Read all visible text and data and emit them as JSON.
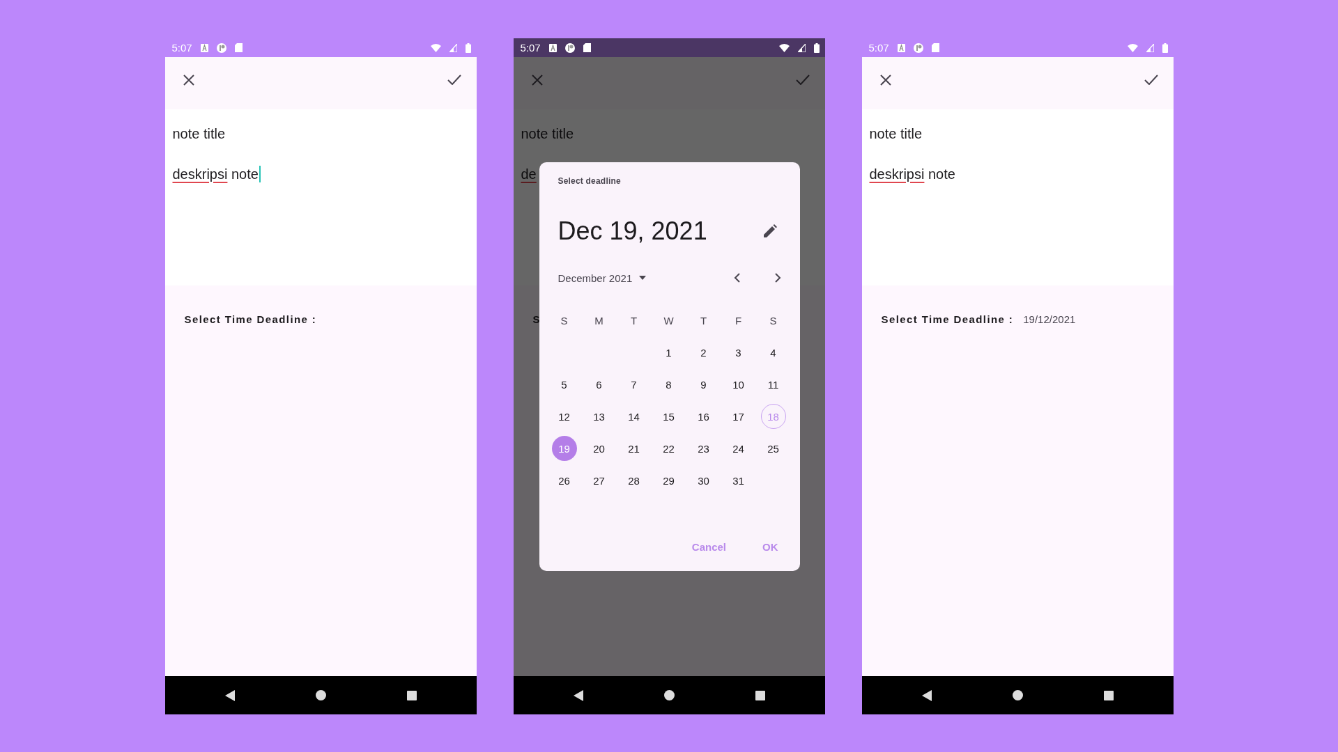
{
  "screens": [
    {
      "status_bar": {
        "time": "5:07"
      },
      "dimmed": false,
      "title": "note title",
      "description": [
        {
          "text": "deskripsi",
          "misspelled": true
        },
        {
          "text": "note",
          "misspelled": false
        }
      ],
      "cursor": true,
      "deadline_label": "Select Time Deadline :"
    },
    {
      "status_bar": {
        "time": "5:07"
      },
      "dimmed": true,
      "title": "note title",
      "description": [
        {
          "text": "de",
          "misspelled": true
        }
      ],
      "cursor": false,
      "deadline_label": "S",
      "dialog": {
        "header": "Select deadline",
        "date": "Dec 19, 2021",
        "month": "December 2021",
        "weekdays": [
          "S",
          "M",
          "T",
          "W",
          "T",
          "F",
          "S"
        ],
        "weeks": [
          [
            {
              "day": "1",
              "selected": false,
              "today": false
            },
            {
              "day": "2",
              "selected": false,
              "today": false
            },
            {
              "day": "3",
              "selected": false,
              "today": false
            },
            {
              "day": "4",
              "selected": false,
              "today": false
            }
          ],
          [
            {
              "day": "5",
              "selected": false,
              "today": false
            },
            {
              "day": "6",
              "selected": false,
              "today": false
            },
            {
              "day": "7",
              "selected": false,
              "today": false
            },
            {
              "day": "8",
              "selected": false,
              "today": false
            },
            {
              "day": "9",
              "selected": false,
              "today": false
            },
            {
              "day": "10",
              "selected": false,
              "today": false
            },
            {
              "day": "11",
              "selected": false,
              "today": false
            }
          ],
          [
            {
              "day": "12",
              "selected": false,
              "today": false
            },
            {
              "day": "13",
              "selected": false,
              "today": false
            },
            {
              "day": "14",
              "selected": false,
              "today": false
            },
            {
              "day": "15",
              "selected": false,
              "today": false
            },
            {
              "day": "16",
              "selected": false,
              "today": false
            },
            {
              "day": "17",
              "selected": false,
              "today": false
            },
            {
              "day": "18",
              "selected": false,
              "today": true
            }
          ],
          [
            {
              "day": "19",
              "selected": true,
              "today": false
            },
            {
              "day": "20",
              "selected": false,
              "today": false
            },
            {
              "day": "21",
              "selected": false,
              "today": false
            },
            {
              "day": "22",
              "selected": false,
              "today": false
            },
            {
              "day": "23",
              "selected": false,
              "today": false
            },
            {
              "day": "24",
              "selected": false,
              "today": false
            },
            {
              "day": "25",
              "selected": false,
              "today": false
            }
          ],
          [
            {
              "day": "26",
              "selected": false,
              "today": false
            },
            {
              "day": "27",
              "selected": false,
              "today": false
            },
            {
              "day": "28",
              "selected": false,
              "today": false
            },
            {
              "day": "29",
              "selected": false,
              "today": false
            },
            {
              "day": "30",
              "selected": false,
              "today": false
            },
            {
              "day": "31",
              "selected": false,
              "today": false
            }
          ]
        ],
        "buttons": [
          "Cancel",
          "OK"
        ]
      }
    },
    {
      "status_bar": {
        "time": "5:07"
      },
      "dimmed": false,
      "title": "note title",
      "description": [
        {
          "text": "deskripsi",
          "misspelled": true
        },
        {
          "text": "note",
          "misspelled": false
        }
      ],
      "cursor": false,
      "deadline_label": "Select Time Deadline :",
      "deadline_value": "19/12/2021"
    }
  ]
}
